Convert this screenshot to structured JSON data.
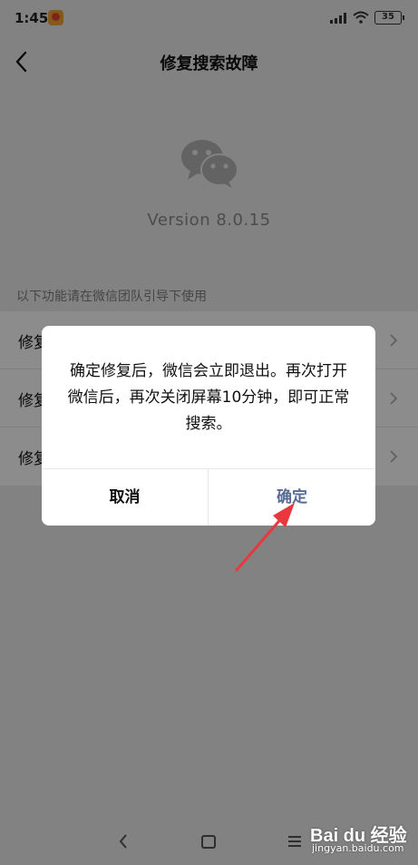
{
  "status_bar": {
    "time": "1:45",
    "battery": "35",
    "icons": [
      "app-notification-icon",
      "signal-icon",
      "wifi-icon",
      "battery-icon"
    ]
  },
  "nav": {
    "title": "修复搜索故障",
    "back_icon": "chevron-left-icon"
  },
  "app": {
    "logo_icon": "wechat-logo-icon",
    "version": "Version 8.0.15"
  },
  "section_hint": "以下功能请在微信团队引导下使用",
  "list": {
    "items": [
      {
        "label": "修复"
      },
      {
        "label": "修复"
      },
      {
        "label": "修复"
      }
    ]
  },
  "dialog": {
    "message": "确定修复后，微信会立即退出。再次打开微信后，再次关闭屏幕10分钟，即可正常搜索。",
    "cancel_label": "取消",
    "confirm_label": "确定"
  },
  "system_nav": {
    "icons": [
      "back-icon",
      "home-icon",
      "menu-icon"
    ]
  },
  "watermark": {
    "logo": "Bai du 经验",
    "url": "jingyan.baidu.com"
  },
  "colors": {
    "dialog_confirm": "#576b95",
    "annotation_arrow": "#e8383d",
    "overlay": "rgba(0,0,0,0.45)"
  }
}
